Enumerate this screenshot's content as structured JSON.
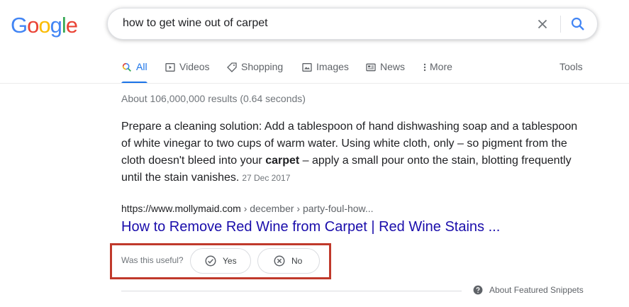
{
  "logo": {
    "letters": [
      "G",
      "o",
      "o",
      "g",
      "l",
      "e"
    ],
    "colors": [
      "#4285f4",
      "#ea4335",
      "#fbbc05",
      "#4285f4",
      "#34a853",
      "#ea4335"
    ]
  },
  "search": {
    "query": "how to get wine out of carpet",
    "clear_icon": "close-icon",
    "search_icon": "search-icon"
  },
  "tabs": [
    {
      "label": "All",
      "icon": "search-icon",
      "active": true
    },
    {
      "label": "Videos",
      "icon": "video-icon",
      "active": false
    },
    {
      "label": "Shopping",
      "icon": "tag-icon",
      "active": false
    },
    {
      "label": "Images",
      "icon": "image-icon",
      "active": false
    },
    {
      "label": "News",
      "icon": "news-icon",
      "active": false
    },
    {
      "label": "More",
      "icon": "more-vert-icon",
      "active": false
    }
  ],
  "tools_label": "Tools",
  "stats": "About 106,000,000 results (0.64 seconds)",
  "snippet": {
    "text_before": "Prepare a cleaning solution: Add a tablespoon of hand dishwashing soap and a tablespoon of white vinegar to two cups of warm water. Using white cloth, only – so pigment from the cloth doesn't bleed into your ",
    "bold": "carpet",
    "text_after": " – apply a small pour onto the stain, blotting frequently until the stain vanishes.",
    "date": "27 Dec 2017"
  },
  "result": {
    "url": "https://www.mollymaid.com",
    "breadcrumbs": " › december › party-foul-how...",
    "title": "How to Remove Red Wine from Carpet | Red Wine Stains ..."
  },
  "feedback": {
    "question": "Was this useful?",
    "yes_label": "Yes",
    "no_label": "No",
    "highlight_color": "#c0392b"
  },
  "about_featured_snippets": "About Featured Snippets",
  "colors": {
    "accent": "#1a73e8",
    "link": "#1a0dab",
    "muted": "#70757a"
  }
}
